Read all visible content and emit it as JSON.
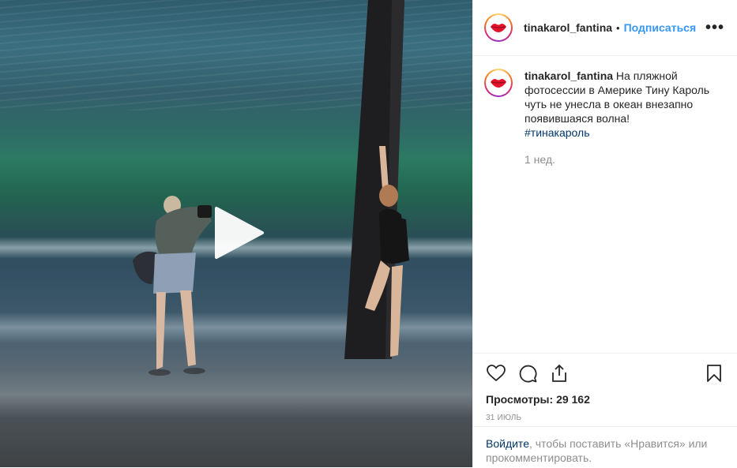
{
  "post": {
    "username": "tinakarol_fantina",
    "separator": "•",
    "follow_label": "Подписаться",
    "more_label": "•••"
  },
  "caption": {
    "username": "tinakarol_fantina",
    "text": " На пляжной фотосессии в Америке Тину Кароль чуть не унесла в океан внезапно появившаяся волна!",
    "hashtag": "#тинакароль",
    "time_ago": "1 нед."
  },
  "stats": {
    "views_label": "Просмотры:",
    "views_count": "29 162",
    "date": "31 ИЮЛЬ"
  },
  "login_prompt": {
    "link": "Войдите",
    "text": ", чтобы поставить «Нравится» или прокомментировать."
  },
  "icons": {
    "like": "heart-icon",
    "comment": "comment-icon",
    "share": "share-icon",
    "save": "bookmark-icon",
    "play": "play-icon",
    "avatar": "lips-icon"
  },
  "colors": {
    "link_blue": "#3897f0",
    "hashtag": "#00376b",
    "muted": "#8e8e8e",
    "text": "#262626"
  }
}
